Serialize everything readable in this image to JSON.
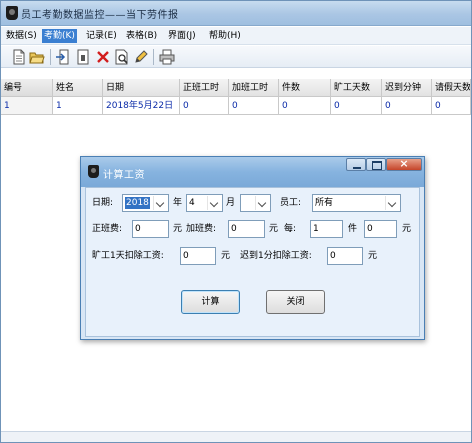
{
  "window": {
    "title": "员工考勤数据监控——当下劳件报"
  },
  "menu": [
    {
      "label": "数据(S)"
    },
    {
      "label": "考勤(K)"
    },
    {
      "label": "记录(E)"
    },
    {
      "label": "表格(B)"
    },
    {
      "label": "界面(J)"
    },
    {
      "label": "帮助(H)"
    }
  ],
  "toolbar": {
    "icons": [
      "new-document-icon",
      "open-folder-icon",
      "import-icon",
      "report-icon",
      "delete-icon",
      "preview-icon",
      "edit-pencil-icon",
      "print-icon"
    ]
  },
  "grid": {
    "headers": [
      "编号",
      "姓名",
      "日期",
      "正班工时",
      "加班工时",
      "件数",
      "旷工天数",
      "迟到分钟",
      "请假天数"
    ],
    "rows": [
      [
        "1",
        "1",
        "2018年5月22日",
        "0",
        "0",
        "0",
        "0",
        "0",
        "0"
      ]
    ]
  },
  "dialog": {
    "title": "计算工资",
    "date_label": "日期:",
    "year_value": "2018",
    "year_unit": "年",
    "month_value": "4",
    "month_unit": "月",
    "day_value": "",
    "employee_label": "员工:",
    "employee_value": "所有",
    "base_pay_label": "正班费:",
    "base_pay_value": "0",
    "yuan_1": "元",
    "overtime_label": "加班费:",
    "overtime_value": "0",
    "yuan_2": "元",
    "piece_label": "每:",
    "piece_value": "1",
    "piece_unit": "件",
    "piece_rate_value": "0",
    "yuan_3": "元",
    "absent_label": "旷工1天扣除工资:",
    "absent_value": "0",
    "yuan_4": "元",
    "late_label": "迟到1分扣除工资:",
    "late_value": "0",
    "yuan_5": "元",
    "calc_button": "计算",
    "close_button": "关闭"
  }
}
